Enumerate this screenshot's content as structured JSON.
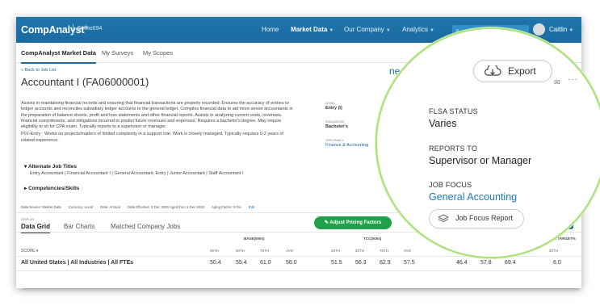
{
  "app": {
    "logo": "CompAnalyst",
    "logo_mark": "®",
    "client": "Demo694"
  },
  "nav": {
    "items": [
      {
        "label": "Home",
        "caret": false
      },
      {
        "label": "Market Data",
        "caret": true
      },
      {
        "label": "Our Company",
        "caret": true
      },
      {
        "label": "Analytics",
        "caret": true
      }
    ],
    "user": "Caitlin"
  },
  "subnav": [
    "CompAnalyst Market Data",
    "My Surveys",
    "My Scopes"
  ],
  "job": {
    "back": "« Back to Job List",
    "title": "Accountant I (FA06000001)",
    "desc1": "Assists in maintaining financial records and ensuring that financial transactions are properly recorded. Ensures the accuracy of entries to ledger accounts and reconciles subsidiary ledger accounts to the general ledger. Compiles financial data to aid more senior accountants in the preparation of balance sheets, profit and loss statements and other financial reports. Assists in analyzing current costs, revenues, financial commitments, and obligations incurred to predict future revenues and expenses. Requires a bachelor's degree. May require eligibility to sit for CPA exam. Typically reports to a supervisor or manager.",
    "desc2": "P01-Entry : Works on projects/matters of limited complexity in a support role. Work is closely managed. Typically requires 0-2 years of related experience.",
    "alt_titles_heading": "Alternate Job Titles",
    "alt_titles": "Entry Accountant | Financial Accountant I | General Accountant, Entry | Junior Accountant | Staff Accountant I",
    "competencies": "Competencies/Skills",
    "level_label": "LEVEL",
    "level": "Entry (I)",
    "education_label": "EDUCATION",
    "education": "Bachelor's",
    "family_label": "JOB FAMILY",
    "family": "Finance & Accounting"
  },
  "infobar": {
    "source": "Data Source: Market Data",
    "currency": "Currency: Local",
    "rate": "Rate: Annual",
    "effective": "Data Effective: 3 Dec 2020 Aged from 1 Dec 2020",
    "aging": "Aging Factor: 0.0%",
    "edit": "Edit"
  },
  "display": {
    "label": "DISPLAY",
    "tabs": [
      "Data Grid",
      "Bar Charts",
      "Matched Company Jobs"
    ],
    "adjust": "Adjust Pricing Factors"
  },
  "grid": {
    "groups": [
      "BASE(000s)",
      "TCC(000s)",
      "BONUS TARGET%"
    ],
    "cols": [
      "25TH",
      "50TH",
      "75TH",
      "AVG",
      "25TH",
      "50TH",
      "75TH",
      "AVG",
      "50TH"
    ],
    "scope_label": "SCOPE",
    "row_label": "All United States | All Industries | All FTEs",
    "values": [
      "50.4",
      "55.4",
      "61.0",
      "56.0",
      "51.5",
      "56.3",
      "62.9",
      "57.5",
      "46.4",
      "57.8",
      "69.4",
      "6.0"
    ]
  },
  "callout": {
    "partial_link": "ned Job",
    "export": "Export",
    "flsa_label": "FLSA STATUS",
    "flsa": "Varies",
    "reports_label": "REPORTS TO",
    "reports": "Supervisor or Manager",
    "focus_label": "JOB FOCUS",
    "focus": "General Accounting",
    "focus_button": "Job Focus Report"
  },
  "colors": {
    "brand": "#1a6aa0",
    "accent_green": "#21a04a",
    "callout_ring": "#a9e07a"
  }
}
